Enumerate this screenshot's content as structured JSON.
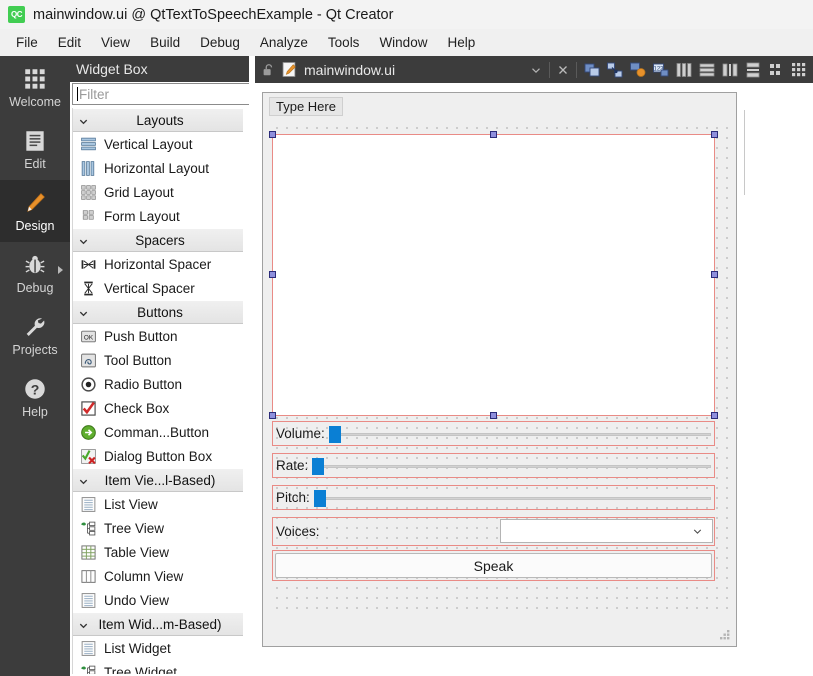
{
  "window": {
    "title": "mainwindow.ui @ QtTextToSpeechExample - Qt Creator",
    "logo_icon": "qt-logo-icon",
    "logo_text": "QC"
  },
  "menubar": {
    "items": [
      {
        "label": "File"
      },
      {
        "label": "Edit"
      },
      {
        "label": "View"
      },
      {
        "label": "Build"
      },
      {
        "label": "Debug"
      },
      {
        "label": "Analyze"
      },
      {
        "label": "Tools"
      },
      {
        "label": "Window"
      },
      {
        "label": "Help"
      }
    ]
  },
  "modebar": {
    "items": [
      {
        "label": "Welcome",
        "icon": "grid-apps-icon",
        "active": false
      },
      {
        "label": "Edit",
        "icon": "document-lines-icon",
        "active": false
      },
      {
        "label": "Design",
        "icon": "pencil-icon",
        "active": true
      },
      {
        "label": "Debug",
        "icon": "bug-icon",
        "active": false,
        "has_arrow": true
      },
      {
        "label": "Projects",
        "icon": "wrench-icon",
        "active": false
      },
      {
        "label": "Help",
        "icon": "question-mark-icon",
        "active": false
      }
    ]
  },
  "widget_box": {
    "title": "Widget Box",
    "filter": {
      "value": "",
      "placeholder": "Filter",
      "icon": "text-caret-icon"
    },
    "groups": [
      {
        "label": "Layouts",
        "expanded": true,
        "chevron_icon": "chevron-down-icon",
        "items": [
          {
            "label": "Vertical Layout",
            "icon": "vertical-layout-icon"
          },
          {
            "label": "Horizontal Layout",
            "icon": "horizontal-layout-icon"
          },
          {
            "label": "Grid Layout",
            "icon": "grid-layout-icon"
          },
          {
            "label": "Form Layout",
            "icon": "form-layout-icon"
          }
        ]
      },
      {
        "label": "Spacers",
        "expanded": true,
        "chevron_icon": "chevron-down-icon",
        "items": [
          {
            "label": "Horizontal Spacer",
            "icon": "horizontal-spacer-icon"
          },
          {
            "label": "Vertical Spacer",
            "icon": "vertical-spacer-icon"
          }
        ]
      },
      {
        "label": "Buttons",
        "expanded": true,
        "chevron_icon": "chevron-down-icon",
        "items": [
          {
            "label": "Push Button",
            "icon": "push-button-icon"
          },
          {
            "label": "Tool Button",
            "icon": "tool-button-icon"
          },
          {
            "label": "Radio Button",
            "icon": "radio-button-icon"
          },
          {
            "label": "Check Box",
            "icon": "check-box-icon"
          },
          {
            "label": "Comman...Button",
            "icon": "command-link-button-icon"
          },
          {
            "label": "Dialog Button Box",
            "icon": "dialog-button-box-icon"
          }
        ]
      },
      {
        "label": "Item Vie...l-Based)",
        "expanded": true,
        "chevron_icon": "chevron-down-icon",
        "items": [
          {
            "label": "List View",
            "icon": "list-view-icon"
          },
          {
            "label": "Tree View",
            "icon": "tree-view-icon"
          },
          {
            "label": "Table View",
            "icon": "table-view-icon"
          },
          {
            "label": "Column View",
            "icon": "column-view-icon"
          },
          {
            "label": "Undo View",
            "icon": "undo-view-icon"
          }
        ]
      },
      {
        "label": "Item Wid...m-Based)",
        "expanded": true,
        "chevron_icon": "chevron-down-icon",
        "items": [
          {
            "label": "List Widget",
            "icon": "list-widget-icon"
          },
          {
            "label": "Tree Widget",
            "icon": "tree-widget-icon"
          }
        ]
      }
    ]
  },
  "editor": {
    "tab": {
      "lock_icon": "unlocked-padlock-icon",
      "file_icon": "ui-file-icon",
      "filename": "mainwindow.ui",
      "dropdown_icon": "chevron-down-icon",
      "close_icon": "close-icon"
    },
    "toolbar": [
      {
        "icon": "edit-widgets-icon"
      },
      {
        "icon": "edit-signals-slots-icon"
      },
      {
        "icon": "edit-buddies-icon"
      },
      {
        "icon": "edit-tab-order-icon"
      },
      {
        "icon": "layout-horizontally-icon"
      },
      {
        "icon": "layout-vertically-icon"
      },
      {
        "icon": "layout-splitter-horizontal-icon"
      },
      {
        "icon": "layout-splitter-vertical-icon"
      },
      {
        "icon": "layout-form-icon"
      },
      {
        "icon": "layout-grid-icon"
      }
    ]
  },
  "form": {
    "menu_placeholder": "Type Here",
    "selection": {
      "handle_count": 8,
      "color": "#8f8fdc",
      "border_color": "#e98b86"
    },
    "rows": [
      {
        "label": "Volume:",
        "control": "slider",
        "value_position": "min",
        "handle_color": "#0a7fd4"
      },
      {
        "label": "Rate:",
        "control": "slider",
        "value_position": "min",
        "handle_color": "#0a7fd4"
      },
      {
        "label": "Pitch:",
        "control": "slider",
        "value_position": "min",
        "handle_color": "#0a7fd4"
      },
      {
        "label": "Voices:",
        "control": "combobox",
        "value": "",
        "dropdown_icon": "chevron-down-icon"
      }
    ],
    "button": {
      "label": "Speak"
    },
    "size_grip_icon": "resize-grip-icon"
  }
}
